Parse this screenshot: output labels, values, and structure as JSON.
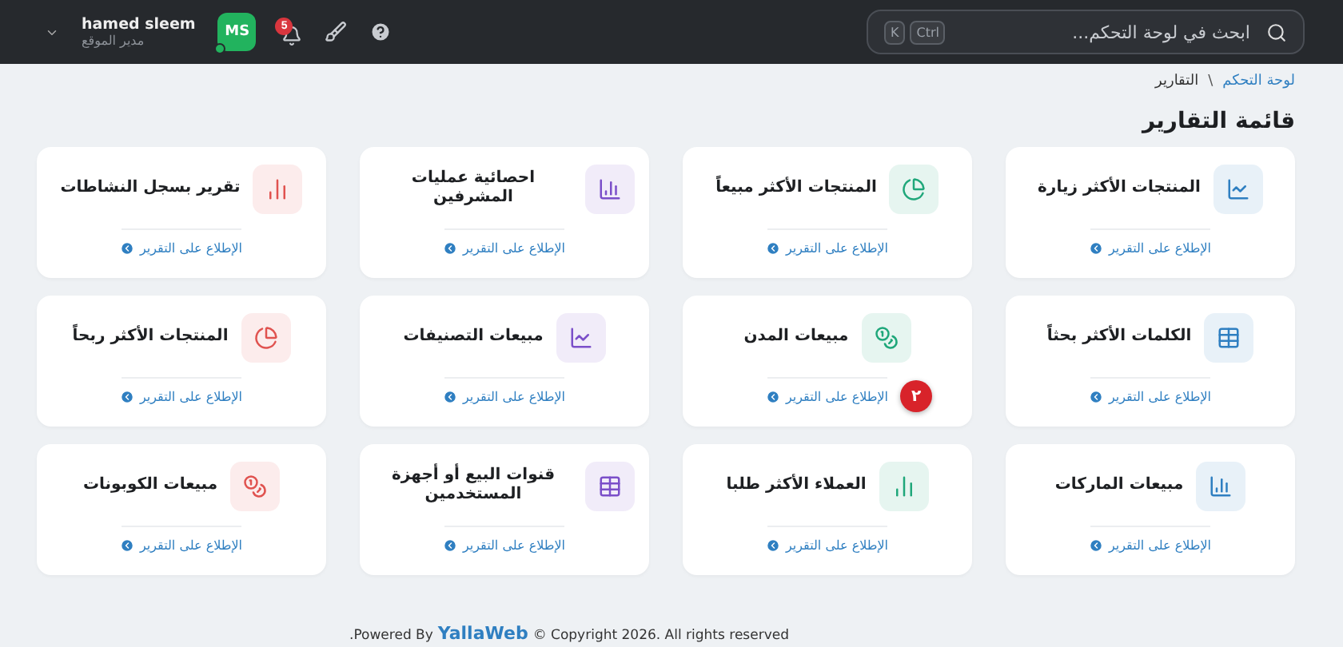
{
  "header": {
    "search": {
      "placeholder": "ابحث في لوحة التحكم...",
      "keys": [
        "Ctrl",
        "K"
      ]
    },
    "notifications_count": "5",
    "user": {
      "initials": "MS",
      "name": "hamed sleem",
      "role": "مدير الموقع",
      "online": true
    }
  },
  "breadcrumb": [
    {
      "label": "لوحة التحكم",
      "link": true
    },
    {
      "label": "التقارير",
      "link": false
    }
  ],
  "breadcrumb_separator": "\\",
  "page_title": "قائمة التقارير",
  "reports": [
    {
      "title": "المنتجات الأكثر زيارة",
      "kind": "line",
      "color": "#2f7fc1",
      "link": "الإطلاع على التقرير"
    },
    {
      "title": "المنتجات الأكثر مبيعاً",
      "kind": "pie",
      "color": "#1fa77a",
      "link": "الإطلاع على التقرير"
    },
    {
      "title": "احصائية عمليات المشرفين",
      "kind": "bars",
      "color": "#7b4fc9",
      "link": "الإطلاع على التقرير"
    },
    {
      "title": "تقرير بسجل النشاطات",
      "kind": "columns",
      "color": "#e0524f",
      "link": "الإطلاع على التقرير"
    },
    {
      "title": "الكلمات الأكثر بحثاً",
      "kind": "table",
      "color": "#2f7fc1",
      "link": "الإطلاع على التقرير"
    },
    {
      "title": "مبيعات المدن",
      "kind": "coins",
      "color": "#1fa77a",
      "link": "الإطلاع على التقرير",
      "badge": "٢"
    },
    {
      "title": "مبيعات التصنيفات",
      "kind": "line",
      "color": "#7b4fc9",
      "link": "الإطلاع على التقرير"
    },
    {
      "title": "المنتجات الأكثر ربحاً",
      "kind": "pie",
      "color": "#e0524f",
      "link": "الإطلاع على التقرير"
    },
    {
      "title": "مبيعات الماركات",
      "kind": "bars",
      "color": "#2f7fc1",
      "link": "الإطلاع على التقرير"
    },
    {
      "title": "العملاء الأكثر طلبا",
      "kind": "columns",
      "color": "#1fa77a",
      "link": "الإطلاع على التقرير"
    },
    {
      "title": "قنوات البيع أو أجهزة المستخدمين",
      "kind": "table",
      "color": "#7b4fc9",
      "link": "الإطلاع على التقرير"
    },
    {
      "title": "مبيعات الكوبونات",
      "kind": "coins",
      "color": "#e0524f",
      "link": "الإطلاع على التقرير"
    }
  ],
  "footer": {
    "prefix": ".Powered By",
    "brand": "YallaWeb",
    "suffix": "© Copyright 2026. All rights reserved"
  }
}
